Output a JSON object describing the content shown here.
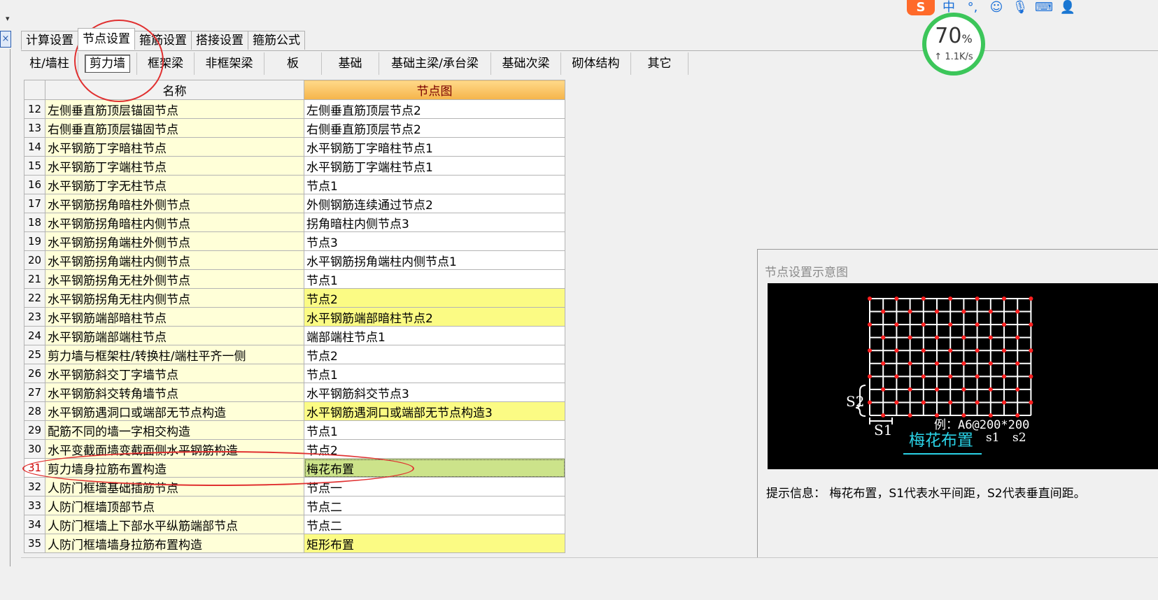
{
  "main_tabs": [
    {
      "label": "计算设置",
      "active": false
    },
    {
      "label": "节点设置",
      "active": true
    },
    {
      "label": "箍筋设置",
      "active": false
    },
    {
      "label": "搭接设置",
      "active": false
    },
    {
      "label": "箍筋公式",
      "active": false
    }
  ],
  "sub_tabs": [
    {
      "label": "柱/墙柱",
      "active": false
    },
    {
      "label": "剪力墙",
      "active": true
    },
    {
      "label": "框架梁",
      "active": false
    },
    {
      "label": "非框架梁",
      "active": false
    },
    {
      "label": "板",
      "active": false
    },
    {
      "label": "基础",
      "active": false
    },
    {
      "label": "基础主梁/承台梁",
      "active": false
    },
    {
      "label": "基础次梁",
      "active": false
    },
    {
      "label": "砌体结构",
      "active": false
    },
    {
      "label": "其它",
      "active": false
    }
  ],
  "grid": {
    "headers": {
      "name": "名称",
      "diagram": "节点图"
    },
    "rows": [
      {
        "num": "12",
        "name": "左侧垂直筋顶层锚固节点",
        "value": "左侧垂直筋顶层节点2",
        "state": ""
      },
      {
        "num": "13",
        "name": "右侧垂直筋顶层锚固节点",
        "value": "右侧垂直筋顶层节点2",
        "state": ""
      },
      {
        "num": "14",
        "name": "水平钢筋丁字暗柱节点",
        "value": "水平钢筋丁字暗柱节点1",
        "state": ""
      },
      {
        "num": "15",
        "name": "水平钢筋丁字端柱节点",
        "value": "水平钢筋丁字端柱节点1",
        "state": ""
      },
      {
        "num": "16",
        "name": "水平钢筋丁字无柱节点",
        "value": "节点1",
        "state": ""
      },
      {
        "num": "17",
        "name": "水平钢筋拐角暗柱外侧节点",
        "value": "外侧钢筋连续通过节点2",
        "state": ""
      },
      {
        "num": "18",
        "name": "水平钢筋拐角暗柱内侧节点",
        "value": "拐角暗柱内侧节点3",
        "state": ""
      },
      {
        "num": "19",
        "name": "水平钢筋拐角端柱外侧节点",
        "value": "节点3",
        "state": ""
      },
      {
        "num": "20",
        "name": "水平钢筋拐角端柱内侧节点",
        "value": "水平钢筋拐角端柱内侧节点1",
        "state": ""
      },
      {
        "num": "21",
        "name": "水平钢筋拐角无柱外侧节点",
        "value": "节点1",
        "state": ""
      },
      {
        "num": "22",
        "name": "水平钢筋拐角无柱内侧节点",
        "value": "节点2",
        "state": "hl"
      },
      {
        "num": "23",
        "name": "水平钢筋端部暗柱节点",
        "value": "水平钢筋端部暗柱节点2",
        "state": "hl"
      },
      {
        "num": "24",
        "name": "水平钢筋端部端柱节点",
        "value": "端部端柱节点1",
        "state": ""
      },
      {
        "num": "25",
        "name": "剪力墙与框架柱/转换柱/端柱平齐一侧",
        "value": "节点2",
        "state": ""
      },
      {
        "num": "26",
        "name": "水平钢筋斜交丁字墙节点",
        "value": "节点1",
        "state": ""
      },
      {
        "num": "27",
        "name": "水平钢筋斜交转角墙节点",
        "value": "水平钢筋斜交节点3",
        "state": ""
      },
      {
        "num": "28",
        "name": "水平钢筋遇洞口或端部无节点构造",
        "value": "水平钢筋遇洞口或端部无节点构造3",
        "state": "hl"
      },
      {
        "num": "29",
        "name": "配筋不同的墙一字相交构造",
        "value": "节点1",
        "state": ""
      },
      {
        "num": "30",
        "name": "水平变截面墙变截面侧水平钢筋构造",
        "value": "节点2",
        "state": ""
      },
      {
        "num": "31",
        "name": "剪力墙身拉筋布置构造",
        "value": "梅花布置",
        "state": "sel"
      },
      {
        "num": "32",
        "name": "人防门框墙基础插筋节点",
        "value": "节点一",
        "state": ""
      },
      {
        "num": "33",
        "name": "人防门框墙顶部节点",
        "value": "节点二",
        "state": ""
      },
      {
        "num": "34",
        "name": "人防门框墙上下部水平纵筋端部节点",
        "value": "节点二",
        "state": ""
      },
      {
        "num": "35",
        "name": "人防门框墙墙身拉筋布置构造",
        "value": "矩形布置",
        "state": "hl"
      }
    ]
  },
  "preview": {
    "title": "节点设置示意图",
    "diagram": {
      "s1_label": "S1",
      "s2_label": "S2",
      "example": "例：A6@200*200",
      "s1_small": "s1",
      "s2_small": "s2",
      "caption": "梅花布置"
    },
    "hint": "提示信息：  梅花布置，S1代表水平间距，S2代表垂直间距。"
  },
  "speed_widget": {
    "percent": "70",
    "percent_sign": "%",
    "rate": "↑ 1.1K/s"
  },
  "ime_bar": {
    "logo": "S",
    "mode": "中",
    "punct": "°,"
  },
  "left_controls": {
    "close": "×",
    "dropdown": "▾"
  },
  "colors": {
    "highlight": "#fbfb84",
    "selected": "#cce38a",
    "name_bg": "#ffffd8",
    "annotation": "#e03030",
    "grid_red": "#ff2020"
  }
}
